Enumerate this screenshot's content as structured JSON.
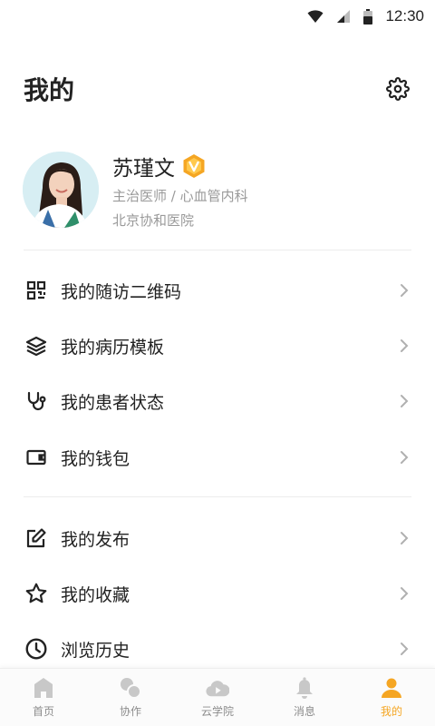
{
  "status_bar": {
    "time": "12:30"
  },
  "header": {
    "title": "我的"
  },
  "profile": {
    "name": "苏瑾文",
    "title": "主治医师 / 心血管内科",
    "hospital": "北京协和医院",
    "badge_icon": "verified-v-icon"
  },
  "menu_group1": [
    {
      "label": "我的随访二维码",
      "icon": "qrcode-icon"
    },
    {
      "label": "我的病历模板",
      "icon": "layers-icon"
    },
    {
      "label": "我的患者状态",
      "icon": "stethoscope-icon"
    },
    {
      "label": "我的钱包",
      "icon": "wallet-icon"
    }
  ],
  "menu_group2": [
    {
      "label": "我的发布",
      "icon": "edit-icon"
    },
    {
      "label": "我的收藏",
      "icon": "star-icon"
    },
    {
      "label": "浏览历史",
      "icon": "clock-icon"
    }
  ],
  "tabs": [
    {
      "label": "首页",
      "icon": "home-icon"
    },
    {
      "label": "协作",
      "icon": "collaborate-icon"
    },
    {
      "label": "云学院",
      "icon": "cloud-play-icon"
    },
    {
      "label": "消息",
      "icon": "bell-icon"
    },
    {
      "label": "我的",
      "icon": "user-icon",
      "active": true
    }
  ],
  "colors": {
    "accent": "#f5a623",
    "text": "#222222",
    "muted": "#9a9a9a",
    "tab_inactive": "#c8c8c8"
  }
}
